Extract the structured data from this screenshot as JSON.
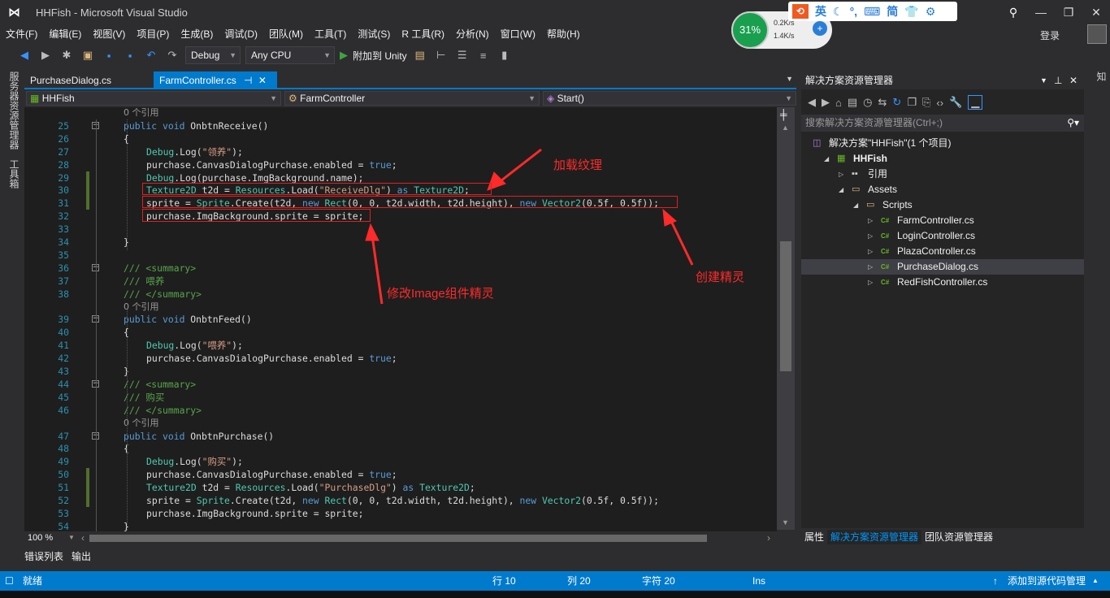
{
  "window": {
    "title": "HHFish - Microsoft Visual Studio",
    "login": "登录",
    "minimize": "—",
    "restore": "❐",
    "close": "✕"
  },
  "menu": [
    "文件(F)",
    "编辑(E)",
    "视图(V)",
    "项目(P)",
    "生成(B)",
    "调试(D)",
    "团队(M)",
    "工具(T)",
    "测试(S)",
    "R 工具(R)",
    "分析(N)",
    "窗口(W)",
    "帮助(H)"
  ],
  "toolbar": {
    "config": "Debug",
    "platform": "Any CPU",
    "attach": "附加到 Unity"
  },
  "overlay": {
    "ime": [
      "英",
      "☾",
      "°,",
      "⌨",
      "简",
      "👕",
      "⚙"
    ],
    "cpu": "31%",
    "up": "0.2K/s",
    "down": "1.4K/s"
  },
  "left_strip": {
    "server_explorer": "服务器资源管理器",
    "toolbox": "工具箱"
  },
  "right_strip": {
    "notifications": "通知"
  },
  "tabs": [
    {
      "label": "PurchaseDialog.cs",
      "active": false
    },
    {
      "label": "FarmController.cs",
      "active": true,
      "pin": "⊣",
      "close": "✕"
    }
  ],
  "navbar": {
    "project": "HHFish",
    "class": "FarmController",
    "member": "Start()"
  },
  "code": [
    {
      "lens": "0 个引用",
      "indent": 0
    },
    {
      "n": 25,
      "indent": 0,
      "fold": true,
      "t": [
        [
          "public void ",
          "kw"
        ],
        [
          "OnbtnReceive()",
          "pl"
        ]
      ]
    },
    {
      "n": 26,
      "indent": 0,
      "t": [
        [
          "{",
          "pl"
        ]
      ]
    },
    {
      "n": 27,
      "indent": 1,
      "t": [
        [
          "Debug",
          "ty"
        ],
        [
          ".Log(",
          "pl"
        ],
        [
          "\"领养\"",
          "st"
        ],
        [
          ");",
          "pl"
        ]
      ]
    },
    {
      "n": 28,
      "indent": 1,
      "t": [
        [
          "purchase.CanvasDialogPurchase.enabled = ",
          "pl"
        ],
        [
          "true",
          "kw"
        ],
        [
          ";",
          "pl"
        ]
      ]
    },
    {
      "n": 29,
      "indent": 1,
      "chg": true,
      "t": [
        [
          "Debug",
          "ty"
        ],
        [
          ".Log(purchase.ImgBackground.name);",
          "pl"
        ]
      ]
    },
    {
      "n": 30,
      "indent": 1,
      "chg": true,
      "t": [
        [
          "Texture2D",
          "ty"
        ],
        [
          " t2d = ",
          "pl"
        ],
        [
          "Resources",
          "ty"
        ],
        [
          ".Load(",
          "pl"
        ],
        [
          "\"ReceiveDlg\"",
          "st"
        ],
        [
          ") ",
          "pl"
        ],
        [
          "as ",
          "kw"
        ],
        [
          "Texture2D",
          "ty"
        ],
        [
          ";",
          "pl"
        ]
      ]
    },
    {
      "n": 31,
      "indent": 1,
      "chg": true,
      "t": [
        [
          "sprite = ",
          "pl"
        ],
        [
          "Sprite",
          "ty"
        ],
        [
          ".Create(t2d, ",
          "pl"
        ],
        [
          "new ",
          "kw"
        ],
        [
          "Rect",
          "ty"
        ],
        [
          "(0, 0, t2d.width, t2d.height), ",
          "pl"
        ],
        [
          "new ",
          "kw"
        ],
        [
          "Vector2",
          "ty"
        ],
        [
          "(0.5f, 0.5f));",
          "pl"
        ]
      ]
    },
    {
      "n": 32,
      "indent": 1,
      "t": [
        [
          "purchase.ImgBackground.sprite = sprite;",
          "pl"
        ]
      ]
    },
    {
      "n": 33,
      "indent": 1,
      "t": []
    },
    {
      "n": 34,
      "indent": 0,
      "t": [
        [
          "}",
          "pl"
        ]
      ]
    },
    {
      "n": 35,
      "indent": 0,
      "t": []
    },
    {
      "n": 36,
      "indent": 0,
      "fold": true,
      "t": [
        [
          "/// <summary>",
          "cm"
        ]
      ]
    },
    {
      "n": 37,
      "indent": 0,
      "t": [
        [
          "/// 喂养",
          "cm"
        ]
      ]
    },
    {
      "n": 38,
      "indent": 0,
      "t": [
        [
          "/// </summary>",
          "cm"
        ]
      ]
    },
    {
      "lens": "0 个引用",
      "indent": 0
    },
    {
      "n": 39,
      "indent": 0,
      "fold": true,
      "t": [
        [
          "public void ",
          "kw"
        ],
        [
          "OnbtnFeed()",
          "pl"
        ]
      ]
    },
    {
      "n": 40,
      "indent": 0,
      "t": [
        [
          "{",
          "pl"
        ]
      ]
    },
    {
      "n": 41,
      "indent": 1,
      "t": [
        [
          "Debug",
          "ty"
        ],
        [
          ".Log(",
          "pl"
        ],
        [
          "\"喂养\"",
          "st"
        ],
        [
          ");",
          "pl"
        ]
      ]
    },
    {
      "n": 42,
      "indent": 1,
      "t": [
        [
          "purchase.CanvasDialogPurchase.enabled = ",
          "pl"
        ],
        [
          "true",
          "kw"
        ],
        [
          ";",
          "pl"
        ]
      ]
    },
    {
      "n": 43,
      "indent": 0,
      "t": [
        [
          "}",
          "pl"
        ]
      ]
    },
    {
      "n": 44,
      "indent": 0,
      "fold": true,
      "t": [
        [
          "/// <summary>",
          "cm"
        ]
      ]
    },
    {
      "n": 45,
      "indent": 0,
      "t": [
        [
          "/// 购买",
          "cm"
        ]
      ]
    },
    {
      "n": 46,
      "indent": 0,
      "t": [
        [
          "/// </summary>",
          "cm"
        ]
      ]
    },
    {
      "lens": "0 个引用",
      "indent": 0
    },
    {
      "n": 47,
      "indent": 0,
      "fold": true,
      "t": [
        [
          "public void ",
          "kw"
        ],
        [
          "OnbtnPurchase()",
          "pl"
        ]
      ]
    },
    {
      "n": 48,
      "indent": 0,
      "t": [
        [
          "{",
          "pl"
        ]
      ]
    },
    {
      "n": 49,
      "indent": 1,
      "t": [
        [
          "Debug",
          "ty"
        ],
        [
          ".Log(",
          "pl"
        ],
        [
          "\"购买\"",
          "st"
        ],
        [
          ");",
          "pl"
        ]
      ]
    },
    {
      "n": 50,
      "indent": 1,
      "chg": true,
      "t": [
        [
          "purchase.CanvasDialogPurchase.enabled = ",
          "pl"
        ],
        [
          "true",
          "kw"
        ],
        [
          ";",
          "pl"
        ]
      ]
    },
    {
      "n": 51,
      "indent": 1,
      "chg": true,
      "t": [
        [
          "Texture2D",
          "ty"
        ],
        [
          " t2d = ",
          "pl"
        ],
        [
          "Resources",
          "ty"
        ],
        [
          ".Load(",
          "pl"
        ],
        [
          "\"PurchaseDlg\"",
          "st"
        ],
        [
          ") ",
          "pl"
        ],
        [
          "as ",
          "kw"
        ],
        [
          "Texture2D",
          "ty"
        ],
        [
          ";",
          "pl"
        ]
      ]
    },
    {
      "n": 52,
      "indent": 1,
      "chg": true,
      "t": [
        [
          "sprite = ",
          "pl"
        ],
        [
          "Sprite",
          "ty"
        ],
        [
          ".Create(t2d, ",
          "pl"
        ],
        [
          "new ",
          "kw"
        ],
        [
          "Rect",
          "ty"
        ],
        [
          "(0, 0, t2d.width, t2d.height), ",
          "pl"
        ],
        [
          "new ",
          "kw"
        ],
        [
          "Vector2",
          "ty"
        ],
        [
          "(0.5f, 0.5f));",
          "pl"
        ]
      ]
    },
    {
      "n": 53,
      "indent": 1,
      "t": [
        [
          "purchase.ImgBackground.sprite = sprite;",
          "pl"
        ]
      ]
    },
    {
      "n": 54,
      "indent": 0,
      "t": [
        [
          "}",
          "pl"
        ]
      ]
    }
  ],
  "annotations": {
    "load_texture": "加载纹理",
    "create_sprite": "创建精灵",
    "modify_sprite": "修改Image组件精灵",
    "color": "#ff2a2a"
  },
  "editor": {
    "zoom": "100 %"
  },
  "bottom_tabs": [
    "错误列表",
    "输出"
  ],
  "status": {
    "ready": "就绪",
    "line": "行 10",
    "col": "列 20",
    "char": "字符 20",
    "mode": "Ins",
    "source_control": "添加到源代码管理"
  },
  "solution_explorer": {
    "title": "解决方案资源管理器",
    "search_placeholder": "搜索解决方案资源管理器(Ctrl+;)",
    "tree": [
      {
        "label": "解决方案\"HHFish\"(1 个项目)",
        "level": 0,
        "icon": "solution-icon"
      },
      {
        "label": "HHFish",
        "level": 0,
        "expanded": true,
        "bold": true,
        "icon": "unity-project-icon"
      },
      {
        "label": "引用",
        "level": 1,
        "expanded": false,
        "icon": "references-icon"
      },
      {
        "label": "Assets",
        "level": 1,
        "expanded": true,
        "icon": "folder-icon"
      },
      {
        "label": "Scripts",
        "level": 2,
        "expanded": true,
        "icon": "folder-icon"
      },
      {
        "label": "FarmController.cs",
        "level": 3,
        "expanded": false,
        "icon": "csharp-icon"
      },
      {
        "label": "LoginController.cs",
        "level": 3,
        "expanded": false,
        "icon": "csharp-icon"
      },
      {
        "label": "PlazaController.cs",
        "level": 3,
        "expanded": false,
        "icon": "csharp-icon"
      },
      {
        "label": "PurchaseDialog.cs",
        "level": 3,
        "expanded": false,
        "selected": true,
        "icon": "csharp-icon"
      },
      {
        "label": "RedFishController.cs",
        "level": 3,
        "expanded": false,
        "icon": "csharp-icon"
      }
    ],
    "tabs": [
      "属性",
      "解决方案资源管理器",
      "团队资源管理器"
    ]
  },
  "colors": {
    "accent": "#007acc",
    "editor_bg": "#1e1e1e",
    "chrome": "#2d2d30"
  }
}
